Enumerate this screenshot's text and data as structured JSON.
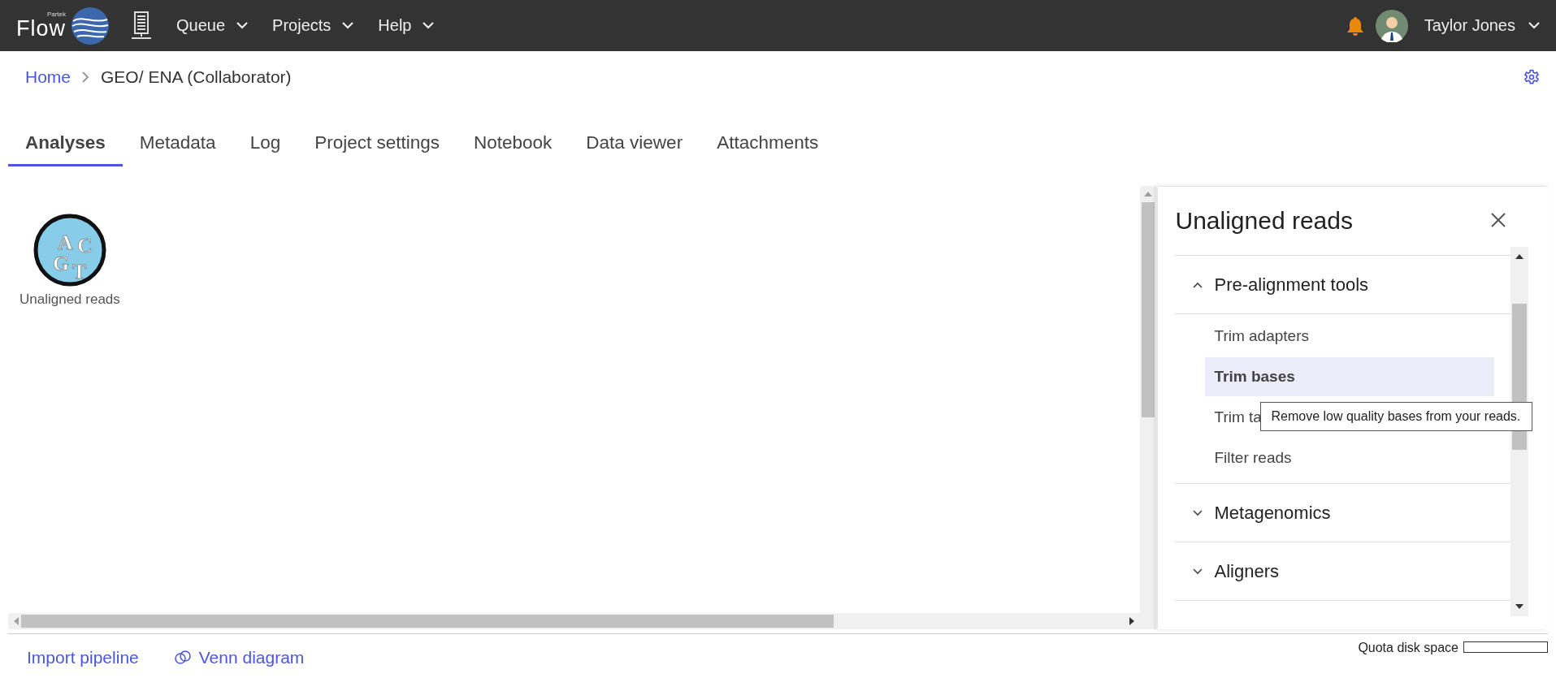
{
  "header": {
    "logo_small": "Partek",
    "logo": "Flow",
    "menus": [
      {
        "label": "Queue"
      },
      {
        "label": "Projects"
      },
      {
        "label": "Help"
      }
    ],
    "user": "Taylor Jones"
  },
  "breadcrumb": {
    "items": [
      "Home",
      "GEO/ ENA (Collaborator)"
    ]
  },
  "tabs": [
    {
      "label": "Analyses",
      "selected": true
    },
    {
      "label": "Metadata",
      "selected": false
    },
    {
      "label": "Log",
      "selected": false
    },
    {
      "label": "Project settings",
      "selected": false
    },
    {
      "label": "Notebook",
      "selected": false
    },
    {
      "label": "Data viewer",
      "selected": false
    },
    {
      "label": "Attachments",
      "selected": false
    }
  ],
  "canvas": {
    "nodes": [
      {
        "label": "Unaligned reads",
        "icon_letters": [
          "A",
          "C",
          "G",
          "T"
        ]
      }
    ]
  },
  "panel": {
    "title": "Unaligned reads",
    "sections": [
      {
        "label": "Pre-alignment tools",
        "expanded": true,
        "items": [
          {
            "label": "Trim adapters",
            "selected": false
          },
          {
            "label": "Trim bases",
            "selected": true
          },
          {
            "label": "Trim ta",
            "selected": false
          },
          {
            "label": "Filter reads",
            "selected": false
          }
        ]
      },
      {
        "label": "Metagenomics",
        "expanded": false
      },
      {
        "label": "Aligners",
        "expanded": false
      }
    ],
    "tooltip": "Remove low quality bases from your reads."
  },
  "footer": {
    "links": [
      {
        "label": "Import pipeline",
        "kind": "plain"
      },
      {
        "label": "Venn diagram",
        "kind": "venn"
      }
    ],
    "quota_label": "Quota disk space",
    "quota": {
      "level": 0
    }
  }
}
